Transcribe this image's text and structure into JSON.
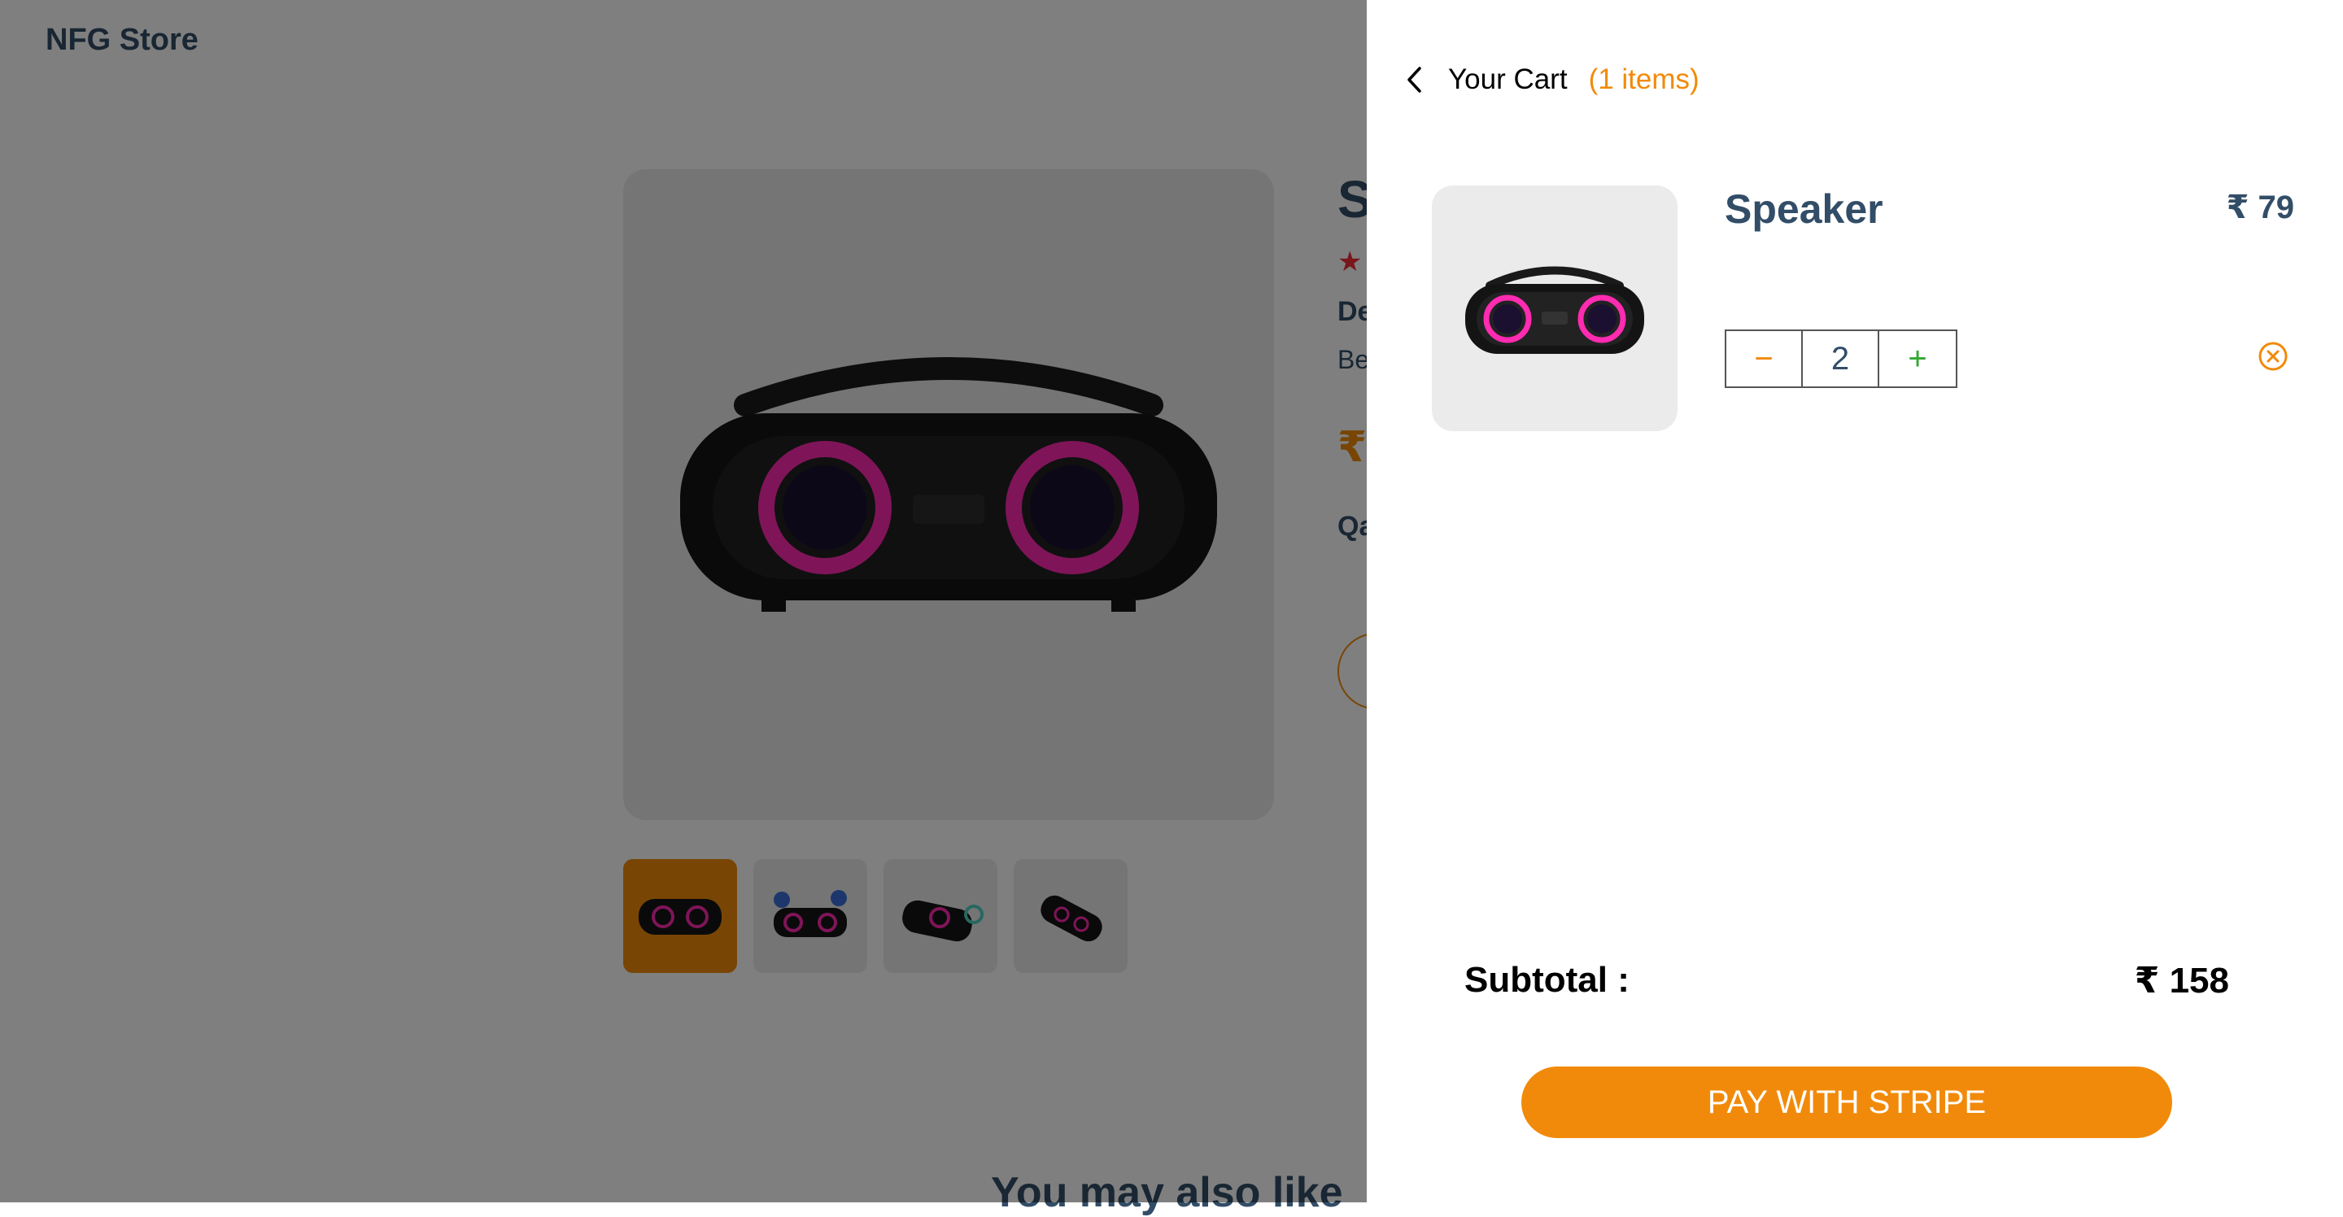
{
  "store": {
    "logo": "NFG Store"
  },
  "product": {
    "title": "S",
    "rating_star": "★",
    "details_heading": "De",
    "details_text": "Be",
    "price_symbol": "₹",
    "quantity_label": "Qa"
  },
  "you_may_also_like": "You may also like",
  "cart": {
    "heading": "Your Cart",
    "count": "(1 items)",
    "items": [
      {
        "name": "Speaker",
        "price": "₹ 79",
        "quantity": "2",
        "minus": "−",
        "plus": "+"
      }
    ],
    "subtotal_label": "Subtotal :",
    "subtotal_value": "₹ 158",
    "pay_button": "PAY WITH STRIPE"
  },
  "colors": {
    "accent": "#f18a0a",
    "text_dark": "#324d67",
    "plus": "#31a831",
    "overlay": "rgba(0,0,0,0.5)"
  },
  "icons": {
    "back": "chevron-left-icon",
    "remove": "close-circle-icon",
    "product": "speaker-icon"
  }
}
